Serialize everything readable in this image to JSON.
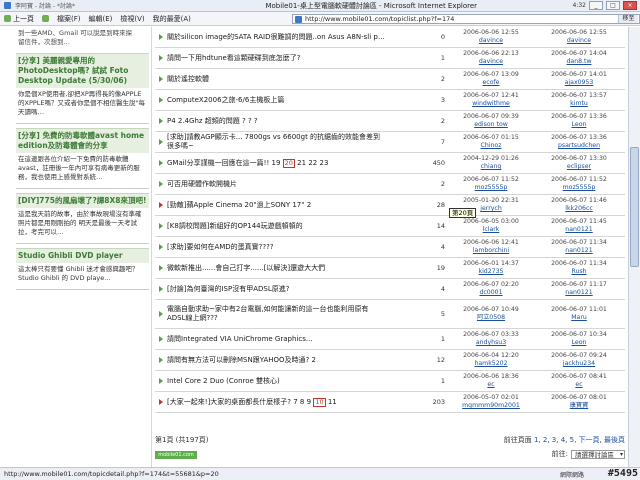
{
  "window": {
    "title": "Mobile01-桌上型電腦軟硬體討論區 - Microsoft Internet Explorer",
    "left_label": "李阿寶 - 討論 - *討論*",
    "time": "4:32"
  },
  "menu": {
    "back": "上一頁",
    "items": [
      "檔案(F)",
      "編輯(E)",
      "檢視(V)",
      "我的最愛(A)"
    ],
    "address": "http://www.mobile01.com/topiclist.php?f=174",
    "go": "移至"
  },
  "sidebar": {
    "top_text": "到一些AMD、Gmail 可以說是到時來探留信件，次想到…",
    "posts": [
      {
        "title": "[分享] 美麗親愛專用的PhotoDesktop嗎? 試試 Foto Desktop Update (5/30/06)",
        "body": "你是個XP使用者,卻把XP再得長的像APPLE的XPPLE嗎？又或者你是個不相信醫生說\"每天讀嗎…"
      },
      {
        "title": "[分享] 免費的防毒軟體avast home edition及防毒體會的分享",
        "body": "在這邊跟各位介紹一下免費的防毒軟體avast，註冊後一年內可享有病毒更新的服務，我也使用上感覺對系統…"
      },
      {
        "title": "[DIY]775的風扇壞了?譚8X8來頂吧!",
        "body": "這是我天前的故事，由於事故現場沒有準確 照片都是用剛剛拍的 明天是最後一天考試拉，考完可以…"
      },
      {
        "title": "Studio Ghibli DVD player",
        "body": "這太棒只有要懂 Ghibli 迷才會感興趣吧？ Studio Ghibli 的 DVD playe…"
      }
    ]
  },
  "topics": [
    {
      "title": "關於silicon image的SATA RAID很難調的問題..on Asus A8N-sli p…",
      "replies": "0",
      "start_date": "2006-06-06 12:55",
      "start_user": "davince",
      "last_date": "2006-06-06 12:55",
      "last_user": "davince",
      "arrow": "green",
      "pages": []
    },
    {
      "title": "請問一下用hdtune看這顆硬碟到底怎麼了?",
      "replies": "1",
      "start_date": "2006-06-06 22:13",
      "start_user": "davince",
      "last_date": "2006-06-07 14:04",
      "last_user": "dan8.tw",
      "arrow": "green",
      "pages": []
    },
    {
      "title": "關於遙控軟體",
      "replies": "2",
      "start_date": "2006-06-07 13:09",
      "start_user": "ecofe",
      "last_date": "2006-06-07 14:01",
      "last_user": "ajax0953",
      "arrow": "green",
      "pages": []
    },
    {
      "title": "ComputeX2006之旅-6/6主機板上篇",
      "replies": "3",
      "start_date": "2006-06-07 12:41",
      "start_user": "windwithme",
      "last_date": "2006-06-07 13:57",
      "last_user": "kimtu",
      "arrow": "green",
      "pages": []
    },
    {
      "title": "P4 2.4Ghz 超頻的問題 ? ? ?",
      "replies": "2",
      "start_date": "2006-06-07 09:39",
      "start_user": "edison tow",
      "last_date": "2006-06-07 13:36",
      "last_user": "Leon",
      "arrow": "green",
      "pages": []
    },
    {
      "title": "[求助]請教AGP顯示卡... 7800gs vs 6600gt 的抗鋸齒的效能會差到很多嗎~",
      "replies": "7",
      "start_date": "2006-06-07 01:15",
      "start_user": "Chinoz",
      "last_date": "2006-06-07 13:36",
      "last_user": "psartsudchen",
      "arrow": "green",
      "pages": []
    },
    {
      "title": "GMail分享謹機一回應在這一篇!!",
      "replies": "450",
      "start_date": "2004-12-29 01:26",
      "start_user": "chiang",
      "last_date": "2006-06-07 13:30",
      "last_user": "eclipser",
      "arrow": "green",
      "pages": [
        "19",
        "20",
        "21",
        "22",
        "23"
      ],
      "active_page": "20"
    },
    {
      "title": "可否用硬體作軟開機片",
      "replies": "2",
      "start_date": "2006-06-07 11:52",
      "start_user": "moz5555p",
      "last_date": "2006-06-07 11:52",
      "last_user": "moz5555p",
      "arrow": "green",
      "pages": []
    },
    {
      "title": "[勁敵]蘋Apple Cinema 20\"過上SONY 17\"",
      "replies": "28",
      "start_date": "2005-01-20 22:31",
      "start_user": "jerrych",
      "last_date": "2006-06-07 11:46",
      "last_user": "lkk206cc",
      "arrow": "red",
      "pages": [
        "2"
      ]
    },
    {
      "title": "[K8調校問題]新組好的OP144玩遊戲頓頓的",
      "replies": "14",
      "start_date": "2006-06-05 03:00",
      "start_user": "lclark",
      "last_date": "2006-06-07 11:45",
      "last_user": "nan0121",
      "arrow": "green",
      "pages": []
    },
    {
      "title": "[求助]要如何在AMD的蛋真實????",
      "replies": "4",
      "start_date": "2006-06-06 12:41",
      "start_user": "lamborchini",
      "last_date": "2006-06-07 11:34",
      "last_user": "nan0121",
      "arrow": "green",
      "pages": []
    },
    {
      "title": "微軟新推出......會自己打字......[以解決]還遊大大們",
      "replies": "19",
      "start_date": "2006-06-01 14:37",
      "start_user": "kid2735",
      "last_date": "2006-06-07 11:34",
      "last_user": "Rush",
      "arrow": "green",
      "pages": []
    },
    {
      "title": "[討論]為何臺灣的ISP沒有甲ADSL原進?",
      "replies": "4",
      "start_date": "2006-06-07 02:20",
      "start_user": "dc0001",
      "last_date": "2006-06-07 11:17",
      "last_user": "nan0121",
      "arrow": "green",
      "pages": []
    },
    {
      "title": "電腦自動求助~家中有2台電腦,如何能讓新的這一台也能利用原有ADSL線上網???",
      "replies": "5",
      "start_date": "2006-06-07 10:49",
      "start_user": "阿立0508",
      "last_date": "2006-06-07 11:01",
      "last_user": "Maru",
      "arrow": "green",
      "pages": [],
      "tall": true
    },
    {
      "title": "請問Integrated VIA UniChrome Graphics...",
      "replies": "1",
      "start_date": "2006-06-07 03:33",
      "start_user": "andyhsu3",
      "last_date": "2006-06-07 10:34",
      "last_user": "Leon",
      "arrow": "green",
      "pages": []
    },
    {
      "title": "請問有無方法可以刪除MSN跟YAHOO及時通?",
      "replies": "12",
      "start_date": "2006-06-04 12:20",
      "start_user": "hamk5202",
      "last_date": "2006-06-07 09:24",
      "last_user": "jackhu234",
      "arrow": "green",
      "pages": [
        "2"
      ]
    },
    {
      "title": "Intel Core 2 Duo (Conroe 雙核心)",
      "replies": "1",
      "start_date": "2006-06-06 18:36",
      "start_user": "ec",
      "last_date": "2006-06-07 08:41",
      "last_user": "ec",
      "arrow": "green",
      "pages": []
    },
    {
      "title": "[大家一起來!]大家的桌面都長什麼樣子?",
      "replies": "203",
      "start_date": "2006-05-07 02:01",
      "start_user": "mgmmm90m2001",
      "last_date": "2006-06-07 08:01",
      "last_user": "康寶寶",
      "arrow": "red",
      "pages": [
        "7",
        "8",
        "9",
        "10",
        "11"
      ],
      "active_page": "10"
    }
  ],
  "tooltip": "第20頁",
  "list_footer": {
    "page_info": "第1頁 (共197頁)",
    "pager_label": "前往頁面",
    "pager_pages": [
      "1",
      "2",
      "3",
      "4",
      "5"
    ],
    "pager_next": "下一頁",
    "pager_last": "最後頁",
    "jump_label": "前往:",
    "jump_value": "請選擇討論區",
    "logo": "mobile01.com"
  },
  "statusbar": {
    "url": "http://www.mobile01.com/topicdetail.php?f=174&t=55681&p=20",
    "zone": "網際網路",
    "tag": "#5495"
  }
}
